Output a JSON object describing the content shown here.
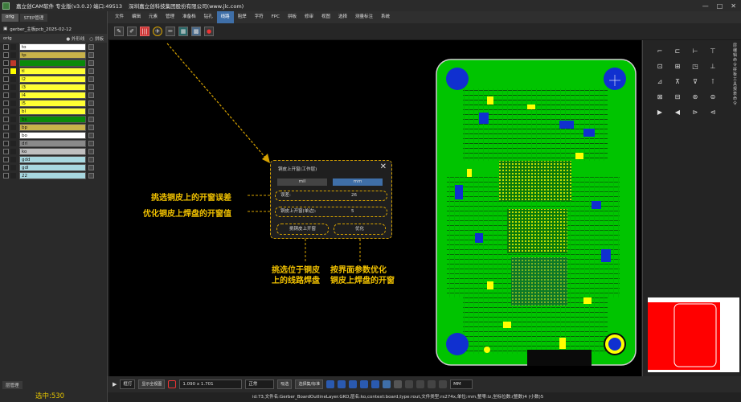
{
  "titlebar": {
    "app": "嘉立创CAM软件 专业版(v3.0.2) 端口:49513",
    "company": "深圳嘉立创科技集团股份有限公司(www.jlc.com)",
    "controls": [
      "—",
      "□",
      "✕"
    ]
  },
  "left": {
    "tabs": [
      "orig",
      "STEP管理"
    ],
    "job": "gerber_主板pcb_2025-02-12",
    "step": "orig",
    "options": [
      "外形线",
      "拼板"
    ],
    "layers": [
      {
        "name": "to",
        "color": "#ffffff",
        "swatch": "#222222"
      },
      {
        "name": "tp",
        "color": "#c8b24a",
        "swatch": "#222222"
      },
      {
        "name": "",
        "color": "#0a8a0a",
        "swatch": "#c0392b"
      },
      {
        "name": "tl",
        "color": "#ffff33",
        "swatch": "#ffff00"
      },
      {
        "name": "l2",
        "color": "#ffff33",
        "swatch": "#222222"
      },
      {
        "name": "l3",
        "color": "#ffff33",
        "swatch": "#222222"
      },
      {
        "name": "l4",
        "color": "#ffff33",
        "swatch": "#222222"
      },
      {
        "name": "l5",
        "color": "#ffff33",
        "swatch": "#222222"
      },
      {
        "name": "bl",
        "color": "#ffff33",
        "swatch": "#222222"
      },
      {
        "name": "bs",
        "color": "#0a8a0a",
        "swatch": "#222222"
      },
      {
        "name": "bp",
        "color": "#c8b24a",
        "swatch": "#222222"
      },
      {
        "name": "bo",
        "color": "#ffffff",
        "swatch": "#222222"
      },
      {
        "name": "drl",
        "color": "#8a8a8a",
        "swatch": "#222222"
      },
      {
        "name": "ko",
        "color": "#bfbfbf",
        "swatch": "#222222"
      },
      {
        "name": "gdd",
        "color": "#a8d8e0",
        "swatch": "#222222"
      },
      {
        "name": "gdl",
        "color": "#a8d8e0",
        "swatch": "#222222"
      },
      {
        "name": "22",
        "color": "#a8d8e0",
        "swatch": "#222222"
      }
    ],
    "layer_manage": "层管理",
    "selected": "选中:530"
  },
  "menu": {
    "items": [
      "文件",
      "编辑",
      "元素",
      "管理",
      "准备档",
      "钻孔",
      "线路",
      "阻焊",
      "字符",
      "FPC",
      "拼板",
      "修审",
      "视图",
      "选择",
      "测量标注",
      "系统"
    ],
    "active": 6
  },
  "dialog": {
    "title": "铜皮上开窗(工作层)",
    "unit_mil": "mil",
    "unit_mm": "mm",
    "row1_label": "误差:",
    "row1_value": "26",
    "row2_label": "铜皮上开窗(单边):",
    "row2_value": "5",
    "btn_pick": "挑铜皮上开窗",
    "btn_opt": "优化"
  },
  "annotations": {
    "a1": "挑选铜皮上的开窗误差",
    "a2": "优化铜皮上焊盘的开窗值",
    "a3a": "挑选位于铜皮",
    "a3b": "上的线路焊盘",
    "a4a": "按界面参数优化",
    "a4b": "铜皮上焊盘的开窗"
  },
  "right_labels": [
    "层",
    "编",
    "辑",
    "命",
    "令",
    "拼",
    "板",
    "工",
    "具",
    "报",
    "表",
    "命",
    "令"
  ],
  "status": {
    "mode": "框打",
    "fit": "显示全视图",
    "size": "1.090 x 1.701",
    "snap": "正常",
    "btn1": "吸选",
    "btn2": "选择集/标准",
    "unit": "MM"
  },
  "info": "id:73,文件名:Gerber_BoardOutlineLayer.GKO,层名:ko,context:board,type:rout,文件类型:rs274x,单位:mm,整零:lz,坐标位数:(整数)4 (小数)5"
}
